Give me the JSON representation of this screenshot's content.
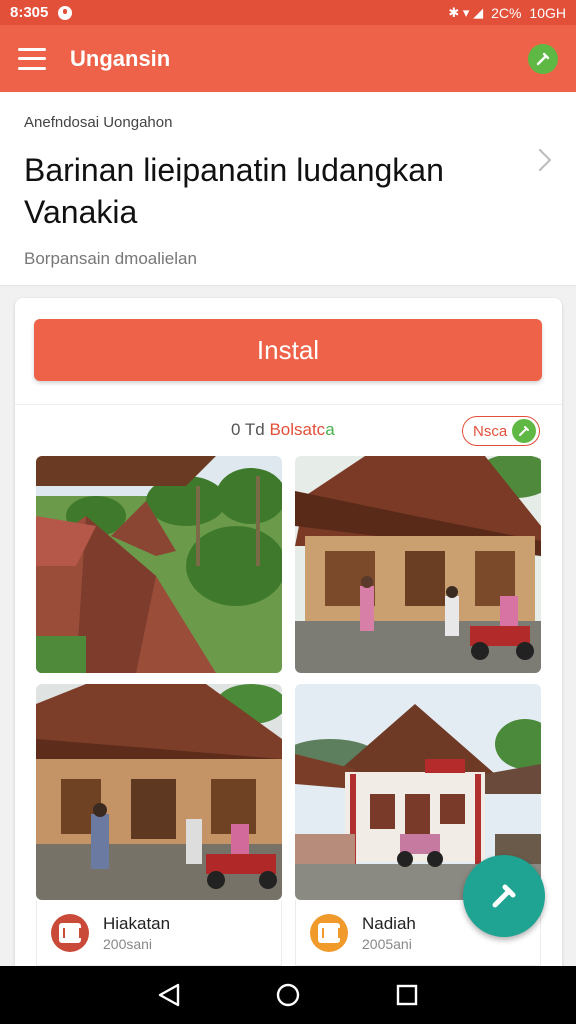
{
  "status_bar": {
    "time": "8:305",
    "indicators": "✱ ▾ ◢",
    "battery_text": "2C%",
    "right_text": "10GH"
  },
  "app_bar": {
    "title": "Ungansin",
    "menu_icon": "hamburger-icon",
    "action_icon": "edit-icon",
    "accent": "#ee6249",
    "action_color": "#5fb843"
  },
  "header": {
    "overline": "Anefndosai Uongahon",
    "headline": "Barinan lieipanatin ludangkan Vanakia",
    "subtitle": "Borpansain dmoalielan"
  },
  "card": {
    "install_label": "Instal",
    "meta_prefix": "0 Td ",
    "meta_accent": "Bolsatc",
    "meta_accent2": "a",
    "chip_label": "Nsca",
    "items": [
      {
        "title": "Hiakatan",
        "subtitle": "200sani",
        "icon": "temple-icon"
      },
      {
        "title": "Nadiah",
        "subtitle": "2005ani",
        "icon": "temple-icon"
      }
    ]
  },
  "fab": {
    "icon": "edit-icon",
    "color": "#1fa393"
  },
  "nav_bar": {
    "back_icon": "back-icon",
    "home_icon": "home-icon",
    "recents_icon": "recents-icon"
  }
}
